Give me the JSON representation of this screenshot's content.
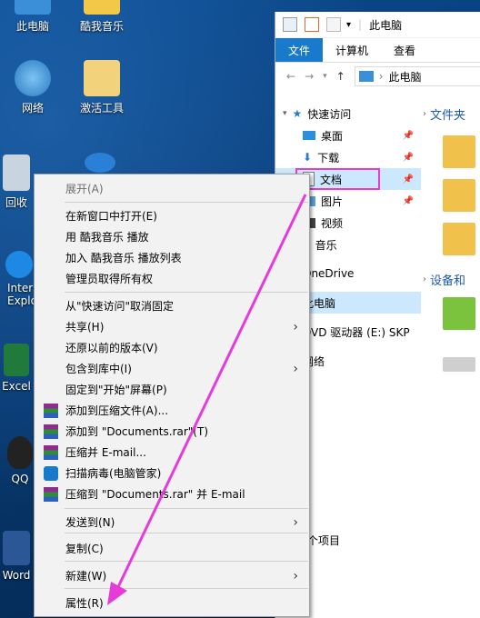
{
  "desktop": {
    "icons": [
      {
        "label": "此电脑"
      },
      {
        "label": "酷我音乐"
      },
      {
        "label": "网络"
      },
      {
        "label": "激活工具"
      },
      {
        "label": "回收"
      },
      {
        "label": "Inter"
      },
      {
        "label": "Explo"
      },
      {
        "label": "Excel"
      },
      {
        "label": "QQ"
      },
      {
        "label": "Word"
      }
    ]
  },
  "explorer": {
    "title": "此电脑",
    "tabs": [
      "文件",
      "计算机",
      "查看"
    ],
    "address": "此电脑",
    "nav": {
      "quick_access": "快速访问",
      "items": [
        "桌面",
        "下载",
        "文档",
        "图片",
        "视频",
        "音乐"
      ],
      "onedrive": "OneDrive",
      "this_pc": "此电脑",
      "dvd": "DVD 驱动器 (E:) SKP",
      "network": "网络"
    },
    "content": {
      "folders_header": "文件夹",
      "devices_header": "设备和"
    },
    "status": "个项目"
  },
  "context_menu": {
    "items": [
      {
        "label": "展开(A)",
        "disabled": true
      },
      {
        "label": "在新窗口中打开(E)"
      },
      {
        "label": "用 酷我音乐 播放"
      },
      {
        "label": "加入 酷我音乐 播放列表"
      },
      {
        "label": "管理员取得所有权"
      },
      {
        "label": "从\"快速访问\"取消固定"
      },
      {
        "label": "共享(H)",
        "submenu": true
      },
      {
        "label": "还原以前的版本(V)"
      },
      {
        "label": "包含到库中(I)",
        "submenu": true
      },
      {
        "label": "固定到\"开始\"屏幕(P)"
      },
      {
        "label": "添加到压缩文件(A)..."
      },
      {
        "label": "添加到 \"Documents.rar\"(T)"
      },
      {
        "label": "压缩并 E-mail..."
      },
      {
        "label": "扫描病毒(电脑管家)"
      },
      {
        "label": "压缩到 \"Documents.rar\" 并 E-mail"
      },
      {
        "label": "发送到(N)",
        "submenu": true
      },
      {
        "label": "复制(C)"
      },
      {
        "label": "新建(W)",
        "submenu": true
      },
      {
        "label": "属性(R)"
      }
    ],
    "submenu_arrow": "›"
  },
  "colors": {
    "highlight": "#e63ad9",
    "accent": "#1979ca",
    "desktop": "#0a3f7c"
  }
}
